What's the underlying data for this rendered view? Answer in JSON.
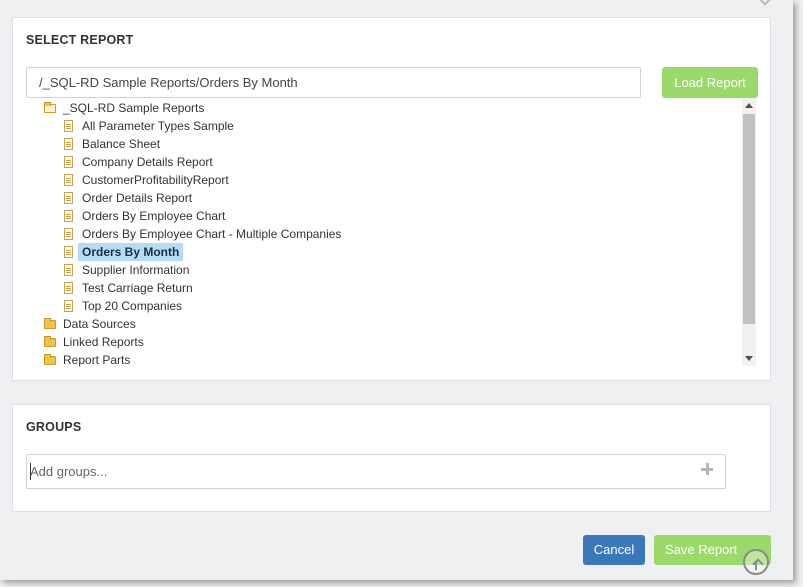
{
  "select_report": {
    "title": "SELECT REPORT",
    "path_value": "/_SQL-RD Sample Reports/Orders By Month",
    "load_button": "Load Report",
    "tree": [
      {
        "label": "_SQL-RD Sample Reports",
        "type": "folder-open",
        "level": 0,
        "selected": false
      },
      {
        "label": "All Parameter Types Sample",
        "type": "report",
        "level": 1,
        "selected": false
      },
      {
        "label": "Balance Sheet",
        "type": "report",
        "level": 1,
        "selected": false
      },
      {
        "label": "Company Details Report",
        "type": "report",
        "level": 1,
        "selected": false
      },
      {
        "label": "CustomerProfitabilityReport",
        "type": "report",
        "level": 1,
        "selected": false
      },
      {
        "label": "Order Details Report",
        "type": "report",
        "level": 1,
        "selected": false
      },
      {
        "label": "Orders By Employee Chart",
        "type": "report",
        "level": 1,
        "selected": false
      },
      {
        "label": "Orders By Employee Chart - Multiple Companies",
        "type": "report",
        "level": 1,
        "selected": false
      },
      {
        "label": "Orders By Month",
        "type": "report",
        "level": 1,
        "selected": true
      },
      {
        "label": "Supplier Information",
        "type": "report",
        "level": 1,
        "selected": false
      },
      {
        "label": "Test Carriage Return",
        "type": "report",
        "level": 1,
        "selected": false
      },
      {
        "label": "Top 20 Companies",
        "type": "report",
        "level": 1,
        "selected": false
      },
      {
        "label": "Data Sources",
        "type": "folder",
        "level": 0,
        "selected": false
      },
      {
        "label": "Linked Reports",
        "type": "folder",
        "level": 0,
        "selected": false
      },
      {
        "label": "Report Parts",
        "type": "folder",
        "level": 0,
        "selected": false
      }
    ]
  },
  "groups": {
    "title": "GROUPS",
    "placeholder": "Add groups..."
  },
  "footer": {
    "cancel_button": "Cancel",
    "save_button": "Save Report"
  },
  "colors": {
    "primary_green": "#9bd96a",
    "cancel_blue": "#3a78b7",
    "selection_blue": "#b6dcf5"
  }
}
